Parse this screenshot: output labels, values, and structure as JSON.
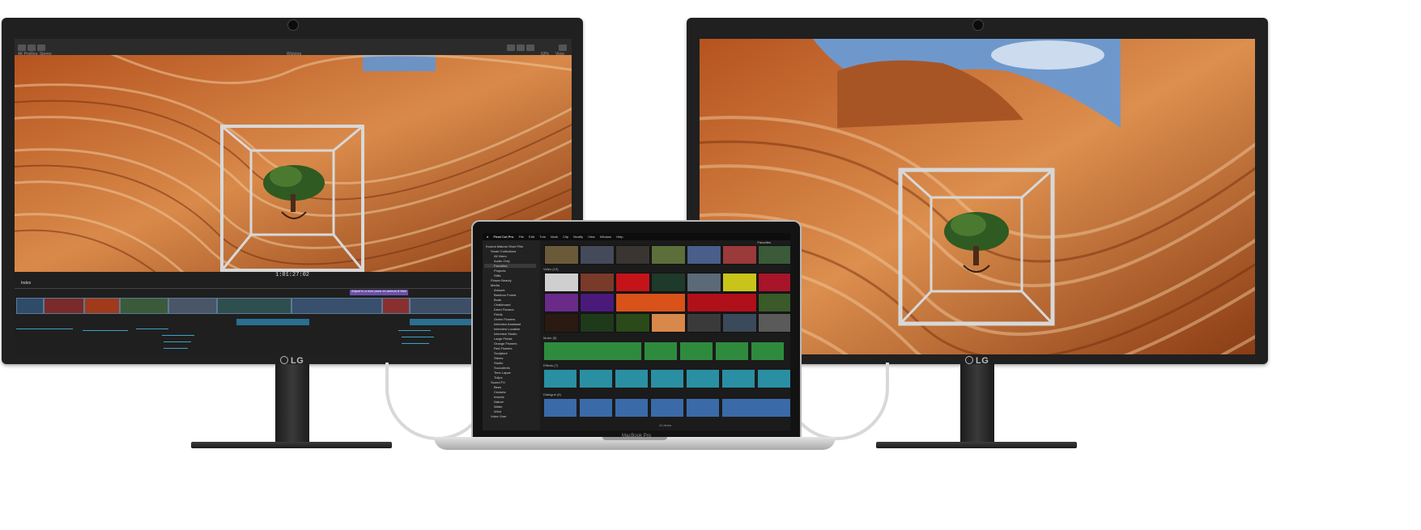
{
  "left_monitor": {
    "brand": "LG",
    "fcp": {
      "project_name": "4K ProRes, Stereo",
      "viewer_label": "Wistoria",
      "zoom": "63%",
      "view_menu": "View",
      "timecode": "1:01:27:02",
      "index_label": "Index",
      "timeline_marker": "Adjust to a nice pace on animal & then"
    }
  },
  "right_monitor": {
    "brand": "LG"
  },
  "laptop": {
    "brand": "MacBook Pro",
    "menubar": [
      "Final Cut Pro",
      "File",
      "Edit",
      "Trim",
      "Mark",
      "Clip",
      "Modify",
      "View",
      "Window",
      "Help"
    ],
    "library_name": "Kouma Makoto Short Film",
    "sidebar_items": [
      "Smart Collections",
      "All Video",
      "Audio Only",
      "Favorites",
      "Projects",
      "Stills",
      "Flower Beauty",
      "Media",
      "Artwork",
      "Bamboo Forest",
      "Buds",
      "Chalkboard",
      "Dried Flowers",
      "Fields",
      "Green Flowers",
      "Interview Assistant",
      "Interview Location",
      "Interview Studio",
      "Large Petals",
      "Orange Flowers",
      "Red Flowers",
      "Sculpture",
      "Stems",
      "Studio",
      "Succulents",
      "Time Lapse",
      "Tulips",
      "Sound FX",
      "Bees",
      "Crickets",
      "Insects",
      "Nature",
      "Water",
      "Wind",
      "Voice Over"
    ],
    "selected_item": "Favorites",
    "browser_filter": "Favorites",
    "sections": [
      {
        "label": "Video",
        "count": "(19)"
      },
      {
        "label": "Music",
        "count": "(5)"
      },
      {
        "label": "Effects",
        "count": "(7)"
      },
      {
        "label": "Dialogue",
        "count": "(6)"
      }
    ],
    "footer": "41 items"
  },
  "colors": {
    "bezel": "#202020",
    "music_wave": "#2e8b3e",
    "effects_wave": "#2a8fa3",
    "dialogue_wave": "#3a6aa8"
  }
}
